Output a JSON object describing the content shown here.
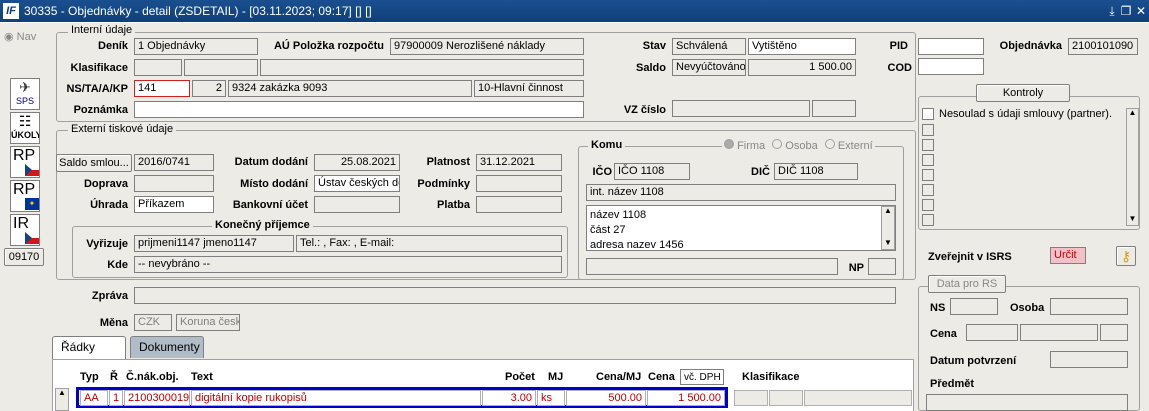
{
  "window": {
    "title": "30335 - Objednávky - detail (ZSDETAIL) - [03.11.2023; 09:17]  [] []",
    "logo": "IF"
  },
  "sidebar": {
    "nav_label": "Nav",
    "buttons": [
      {
        "label": "SPS"
      },
      {
        "label": "ÚKOLY"
      },
      {
        "label": "RP"
      },
      {
        "label": "RP"
      },
      {
        "label": "IR"
      }
    ],
    "code": "09170"
  },
  "internal": {
    "group_title": "Interní údaje",
    "denik_label": "Deník",
    "denik_value": "1 Objednávky",
    "au_label": "AÚ Položka rozpočtu",
    "au_value": "97900009 Nerozlišené náklady",
    "stav_label": "Stav",
    "stav_value": "Schválená",
    "stav_value2": "Vytištěno",
    "pid_label": "PID",
    "objednavka_label": "Objednávka",
    "objednavka_value": "2100101090",
    "klasifikace_label": "Klasifikace",
    "saldo_label": "Saldo",
    "saldo_status": "Nevyúčtováno",
    "saldo_amount": "1 500.00",
    "cod_label": "COD",
    "ns_label": "NS/TA/A/KP",
    "ns_value": "141",
    "ta_value": "2",
    "a_value": "9324 zakázka 9093",
    "kp_value": "10-Hlavní činnost",
    "poznamka_label": "Poznámka",
    "vz_label": "VZ číslo"
  },
  "kontroly": {
    "button": "Kontroly",
    "items": [
      "Nesoulad s údaji smlouvy (partner)."
    ]
  },
  "external": {
    "group_title": "Externí tiskové údaje",
    "saldo_button": "Saldo smlou...",
    "saldo_value": "2016/0741",
    "datum_label": "Datum dodání",
    "datum_value": "25.08.2021",
    "platnost_label": "Platnost",
    "platnost_value": "31.12.2021",
    "doprava_label": "Doprava",
    "misto_label": "Místo dodání",
    "misto_value": "Ústav českých dě",
    "podminky_label": "Podmínky",
    "uhrada_label": "Úhrada",
    "uhrada_value": "Příkazem",
    "bankovni_label": "Bankovní účet",
    "platba_label": "Platba",
    "prijemce_title": "Konečný příjemce",
    "vyrizuje_label": "Vyřizuje",
    "vyrizuje_value": "prijmeni1147 jmeno1147",
    "contact_value": "Tel.: , Fax: , E-mail:",
    "kde_label": "Kde",
    "kde_value": "-- nevybráno --"
  },
  "komu": {
    "title": "Komu",
    "radio_firma": "Firma",
    "radio_osoba": "Osoba",
    "radio_externi": "Externí",
    "ico_label": "IČO",
    "ico_value": "IČO 1108",
    "dic_label": "DIČ",
    "dic_value": "DIČ 1108",
    "int_name": "int. název 1108",
    "address_lines": [
      "název 1108",
      "část 27",
      "adresa nazev 1456"
    ],
    "np_label": "NP"
  },
  "zprava_label": "Zpráva",
  "mena": {
    "label": "Měna",
    "code": "CZK",
    "name": "Koruna česk"
  },
  "isrs": {
    "label": "Zveřejnit v ISRS",
    "value": "Určit"
  },
  "data_rs": {
    "title": "Data pro RS",
    "ns_label": "NS",
    "osoba_label": "Osoba",
    "cena_label": "Cena",
    "datum_label": "Datum potvrzení",
    "predmet_label": "Předmět"
  },
  "tabs": {
    "radky": "Řádky",
    "dokumenty": "Dokumenty"
  },
  "grid": {
    "headers": {
      "typ": "Typ",
      "r": "Ř",
      "cnak": "Č.nák.obj.",
      "text": "Text",
      "pocet": "Počet",
      "mj": "MJ",
      "cena_mj": "Cena/MJ",
      "cena": "Cena",
      "dph": "vč. DPH",
      "klas": "Klasifikace"
    },
    "row": {
      "typ": "AA",
      "r": "1",
      "cnak": "2100300019",
      "text": "digitální kopie rukopisů",
      "pocet": "3.00",
      "mj": "ks",
      "cena_mj": "500.00",
      "cena": "1 500.00"
    }
  },
  "colors": {
    "titlebar": "#0f3f7a",
    "row_text": "#c00000",
    "row_highlight": "#0000cc",
    "isrs_bg": "#f4c0c8"
  }
}
